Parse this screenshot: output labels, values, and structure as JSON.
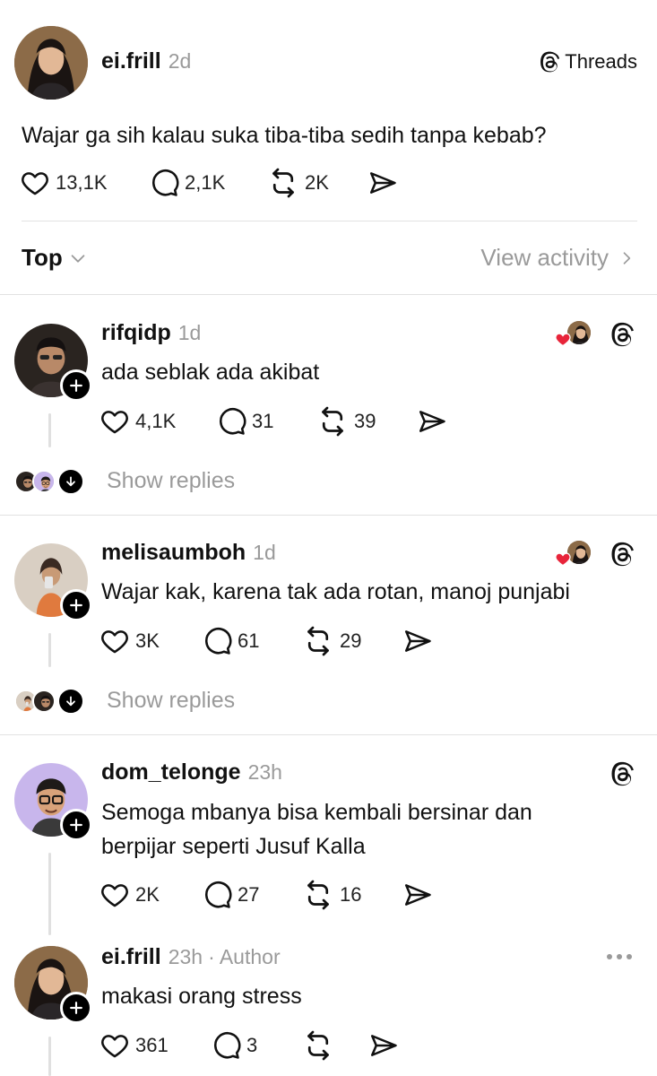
{
  "post": {
    "username": "ei.frill",
    "time": "2d",
    "brand": "Threads",
    "text": "Wajar ga sih kalau suka tiba-tiba sedih tanpa kebab?",
    "likes": "13,1K",
    "comments": "2,1K",
    "reposts": "2K"
  },
  "filter": {
    "sort_label": "Top",
    "activity_label": "View activity"
  },
  "replies": [
    {
      "username": "rifqidp",
      "time": "1d",
      "text": "ada seblak ada akibat",
      "likes": "4,1K",
      "comments": "31",
      "reposts": "39",
      "show_replies": "Show replies"
    },
    {
      "username": "melisaumboh",
      "time": "1d",
      "text": "Wajar kak, karena tak ada rotan, manoj punjabi",
      "likes": "3K",
      "comments": "61",
      "reposts": "29",
      "show_replies": "Show replies"
    },
    {
      "username": "dom_telonge",
      "time": "23h",
      "text_line1": "Semoga mbanya bisa kembali  bersinar dan",
      "text_line2": "berpijar seperti Jusuf Kalla",
      "likes": "2K",
      "comments": "27",
      "reposts": "16"
    },
    {
      "username": "ei.frill",
      "time": "23h",
      "author_tag": "· Author",
      "text": "makasi orang stress",
      "likes": "361",
      "comments": "3",
      "reposts": ""
    }
  ],
  "colors": {
    "text": "#111111",
    "muted": "#9a9a9a",
    "divider": "#e2e2e2",
    "heart_red": "#e8243a"
  },
  "icons": [
    "heart-icon",
    "comment-icon",
    "repost-icon",
    "share-icon",
    "threads-logo-icon",
    "plus-icon",
    "chevron-down-icon",
    "chevron-right-icon",
    "arrow-down-icon",
    "more-icon"
  ]
}
